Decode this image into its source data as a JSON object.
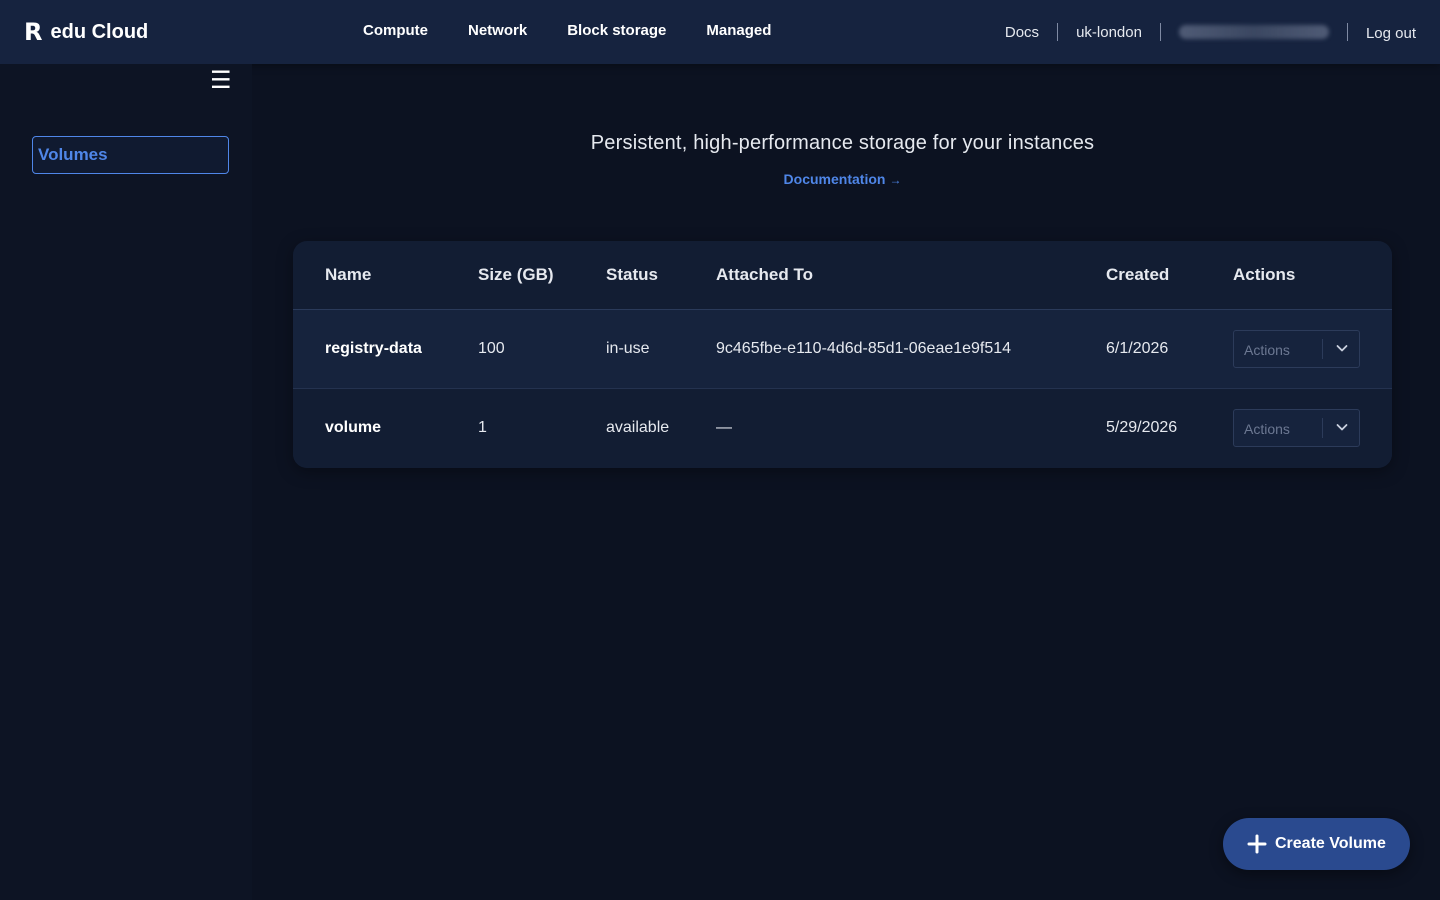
{
  "brand": {
    "logo": "R",
    "name": "edu Cloud"
  },
  "topnav": {
    "links": [
      "Compute",
      "Network",
      "Block storage",
      "Managed"
    ],
    "docs": "Docs",
    "region": "uk-london",
    "logout": "Log out"
  },
  "sidebar": {
    "menu_icon": "hamburger-icon",
    "items": [
      {
        "label": "Volumes",
        "active": true
      }
    ]
  },
  "main": {
    "subtitle": "Persistent, high-performance storage for your instances",
    "doc_link": "Documentation",
    "doc_arrow": "→"
  },
  "table": {
    "columns": [
      "Name",
      "Size (GB)",
      "Status",
      "Attached To",
      "Created",
      "Actions"
    ],
    "rows": [
      {
        "name": "registry-data",
        "size": "100",
        "status": "in-use",
        "attached": "9c465fbe-e110-4d6d-85d1-06eae1e9f514",
        "created": "6/1/2026",
        "action": "Actions"
      },
      {
        "name": "volume",
        "size": "1",
        "status": "available",
        "attached": "—",
        "created": "5/29/2026",
        "action": "Actions"
      }
    ]
  },
  "fab": {
    "label": "Create Volume",
    "icon": "plus-icon"
  },
  "colors": {
    "accent": "#4f86e8",
    "topbar": "#16233f",
    "background": "#0c1221",
    "button": "#2a4a8f"
  }
}
